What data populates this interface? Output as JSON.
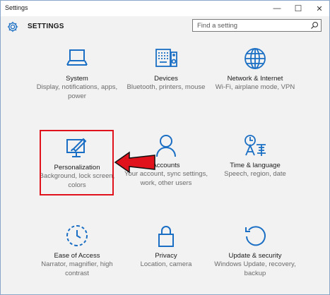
{
  "window": {
    "title": "Settings",
    "controls": {
      "minimize": "—",
      "maximize": "☐",
      "close": "✕"
    }
  },
  "header": {
    "title": "SETTINGS",
    "search_placeholder": "Find a setting"
  },
  "colors": {
    "accent": "#1a6fc4",
    "highlight_border": "#e0121b",
    "arrow_fill": "#e0121b"
  },
  "tiles": [
    {
      "name": "System",
      "description": "Display, notifications, apps, power",
      "icon": "laptop-icon"
    },
    {
      "name": "Devices",
      "description": "Bluetooth, printers, mouse",
      "icon": "devices-icon"
    },
    {
      "name": "Network & Internet",
      "description": "Wi-Fi, airplane mode, VPN",
      "icon": "globe-icon"
    },
    {
      "name": "Personalization",
      "description": "Background, lock screen, colors",
      "icon": "personalization-icon"
    },
    {
      "name": "Accounts",
      "description": "Your account, sync settings, work, other users",
      "icon": "person-icon"
    },
    {
      "name": "Time & language",
      "description": "Speech, region, date",
      "icon": "time-language-icon"
    },
    {
      "name": "Ease of Access",
      "description": "Narrator, magnifier, high contrast",
      "icon": "ease-of-access-icon"
    },
    {
      "name": "Privacy",
      "description": "Location, camera",
      "icon": "lock-icon"
    },
    {
      "name": "Update & security",
      "description": "Windows Update, recovery, backup",
      "icon": "update-icon"
    }
  ]
}
